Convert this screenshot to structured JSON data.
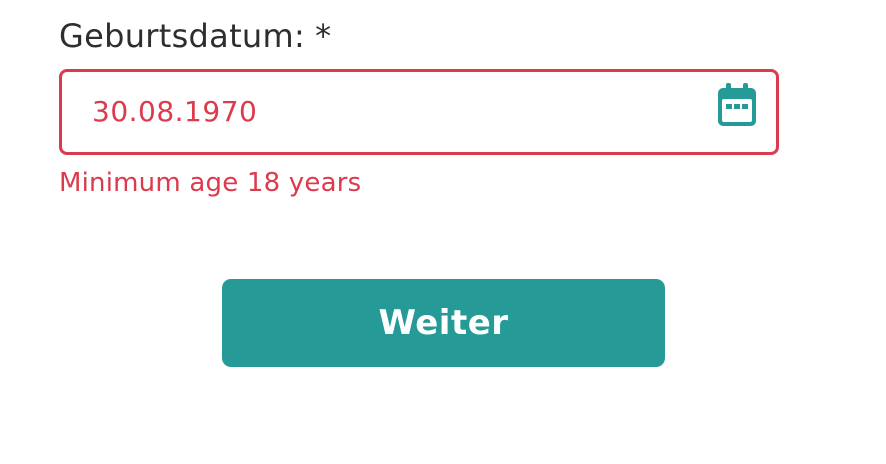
{
  "form": {
    "birthdate_label": "Geburtsdatum:",
    "required_marker": "*",
    "birthdate_value": "30.08.1970",
    "error_message": "Minimum age 18 years",
    "submit_label": "Weiter"
  },
  "icons": {
    "date_picker": "calendar-icon"
  },
  "colors": {
    "error": "#dc3a4d",
    "accent": "#259a96",
    "label": "#2e2e2e"
  }
}
